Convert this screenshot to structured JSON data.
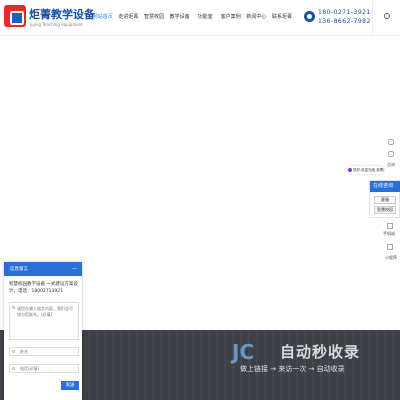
{
  "header": {
    "brand_name": "炬菁教学设备",
    "brand_sub": "Jujing Teaching equipment",
    "nav": [
      "网站首页",
      "走进炬菁",
      "智慧校园",
      "教学设备",
      "功能室",
      "客户案例",
      "新闻中心",
      "联系炬菁"
    ],
    "phone1": "180-0271-3921",
    "phone2": "136-8662-7982"
  },
  "side": {
    "bubble": "您好,欢迎光临 炬菁教育设备有限公司",
    "mini_text": "咨询",
    "online_title": "在线咨询",
    "online_btn1": "客服",
    "online_btn2": "智慧校园",
    "label3": "手机站",
    "label4": "小程序"
  },
  "chat": {
    "title": "信息留言",
    "minimize": "—",
    "message": "智慧校园教学设备 一式建设方案设计，电话：18002713921",
    "textarea_placeholder": "请您在输入留言内容，我们会尽快与您联系。(必填)",
    "name_placeholder": "姓名",
    "phone_placeholder": "电话(必填)",
    "send_label": "发送"
  },
  "watermark": {
    "logo": "JC",
    "title": "自动秒收录",
    "sub": "做上链接 → 来访一次 → 自动收录"
  },
  "colors": {
    "brand_blue": "#1a4fa8",
    "accent_blue": "#2a6fd6",
    "logo_red": "#e8282d",
    "dark_band": "#3e4047"
  }
}
